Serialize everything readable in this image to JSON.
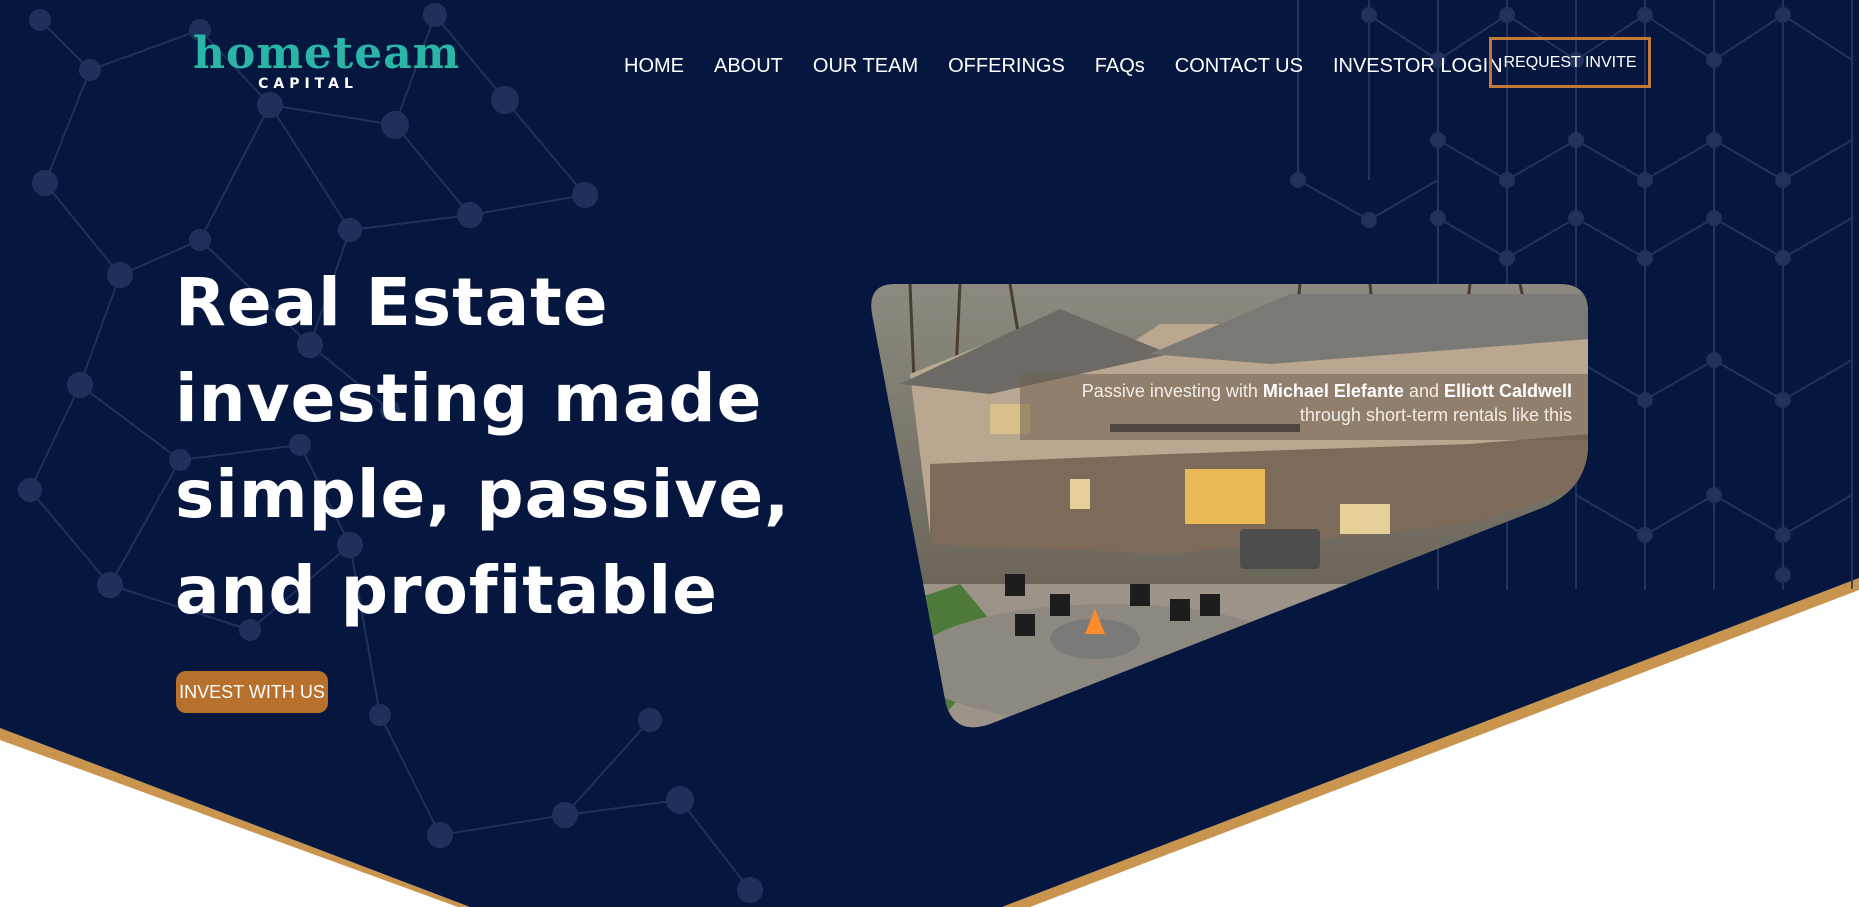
{
  "header": {
    "logo_main": "hometeam",
    "logo_sub": "CAPITAL",
    "nav": [
      {
        "label": "HOME"
      },
      {
        "label": "ABOUT"
      },
      {
        "label": "OUR TEAM"
      },
      {
        "label": "OFFERINGS"
      },
      {
        "label": "FAQs"
      },
      {
        "label": "CONTACT US"
      },
      {
        "label": "INVESTOR LOGIN"
      }
    ],
    "request_label": "REQUEST INVITE"
  },
  "hero": {
    "headline_lines": [
      "Real Estate",
      "investing made",
      "simple, passive,",
      "and profitable"
    ],
    "cta_label": "INVEST WITH US",
    "caption": {
      "prefix": "Passive investing with ",
      "name1": "Michael Elefante",
      "mid": " and ",
      "name2": "Elliott Caldwell",
      "line2": "through short-term rentals like this"
    }
  },
  "colors": {
    "navy": "#06173f",
    "accent": "#c27a3a",
    "teal": "#2bb5a8",
    "gold_stripe": "#c9954e"
  }
}
